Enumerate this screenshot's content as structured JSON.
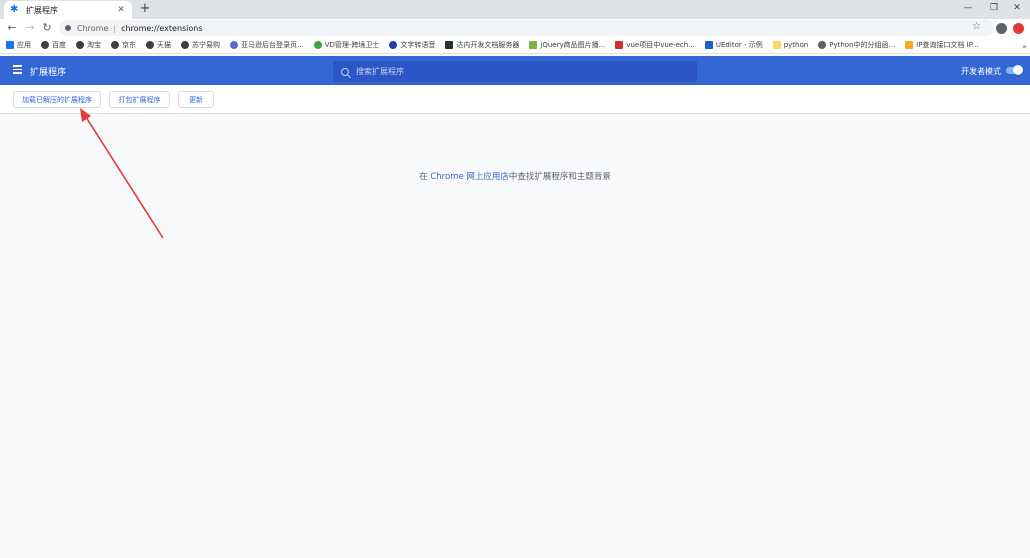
{
  "browser": {
    "tab": {
      "title": "扩展程序"
    },
    "address": {
      "site": "Chrome",
      "separator": "|",
      "url": "chrome://extensions"
    },
    "bookmarks": [
      "应用",
      "百度",
      "淘宝",
      "京东",
      "天猫",
      "苏宁易购",
      "亚马逊后台登录页...",
      "VD管理-跨境卫士",
      "文字转语音",
      "达内开发文档服务器",
      "jQuery商品图片播...",
      "vue项目中vue-ech...",
      "UEditor - 示例",
      "python",
      "Python中的分组函...",
      "IP查询接口文档 IP..."
    ]
  },
  "header": {
    "title": "扩展程序",
    "search_placeholder": "搜索扩展程序",
    "dev_mode_label": "开发者模式",
    "dev_mode_on": true
  },
  "actions": {
    "load_unpacked": "加载已解压的扩展程序",
    "pack": "打包扩展程序",
    "update": "更新"
  },
  "empty": {
    "prefix": "在",
    "link": "Chrome 网上应用店",
    "suffix": "中查找扩展程序和主题背景"
  },
  "colors": {
    "header": "#3367d6",
    "arrow": "#e53935"
  }
}
